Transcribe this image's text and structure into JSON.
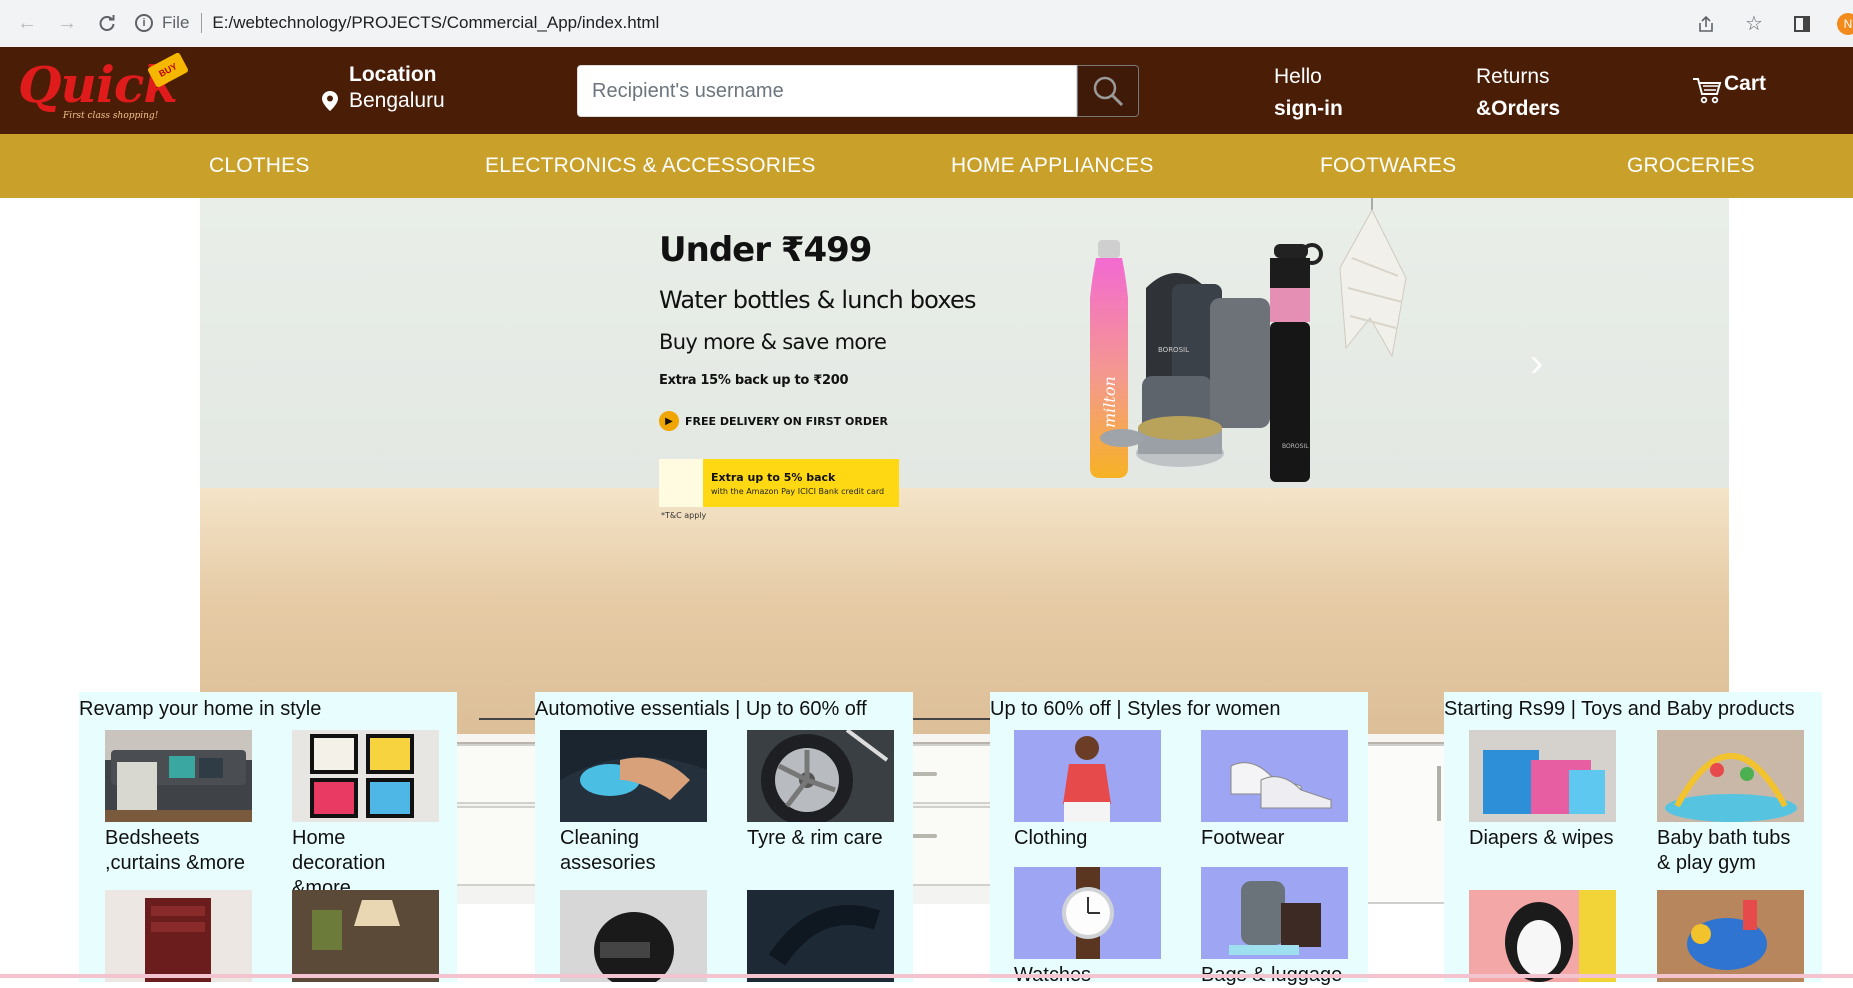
{
  "browser": {
    "scheme_label": "File",
    "url": "E:/webtechnology/PROJECTS/Commercial_App/index.html",
    "profile_initial": "N"
  },
  "header": {
    "logo": {
      "name": "Quick",
      "tagline": "First class shopping!",
      "badge": "BUY"
    },
    "location": {
      "label": "Location",
      "city": "Bengaluru"
    },
    "search": {
      "placeholder": "Recipient's username"
    },
    "account": {
      "line1": "Hello",
      "line2": "sign-in"
    },
    "orders": {
      "line1": "Returns",
      "line2": "&Orders"
    },
    "cart_label": "Cart"
  },
  "categories": [
    "CLOTHES",
    "ELECTRONICS & ACCESSORIES",
    "HOME APPLIANCES",
    "FOOTWARES",
    "GROCERIES"
  ],
  "hero": {
    "headline": "Under ₹499",
    "subhead": "Water bottles & lunch boxes",
    "tagline": "Buy more & save more",
    "offer": "Extra 15% back up to ₹200",
    "delivery": "FREE DELIVERY ON FIRST ORDER",
    "card_title": "Extra up to 5% back",
    "card_sub": "with the Amazon Pay ICICI Bank credit card",
    "tnc": "*T&C apply",
    "bottle_brand": "milton",
    "lunchbox_brand": "BOROSIL"
  },
  "cards": [
    {
      "title": "Revamp your home in style",
      "tiles": [
        {
          "label": "Bedsheets ,curtains &more",
          "icon": "sofa-image"
        },
        {
          "label": "Home decoration &more",
          "icon": "frames-image"
        },
        {
          "label": "",
          "icon": "shoe-rack-image"
        },
        {
          "label": "",
          "icon": "lamp-image"
        }
      ]
    },
    {
      "title": "Automotive essentials | Up to 60% off",
      "tiles": [
        {
          "label": "Cleaning assesories",
          "icon": "car-cleaning-image"
        },
        {
          "label": "Tyre & rim care",
          "icon": "tyre-image"
        },
        {
          "label": "",
          "icon": "helmet-image"
        },
        {
          "label": "",
          "icon": "vacuum-image"
        }
      ]
    },
    {
      "title": "Up to 60% off | Styles for women",
      "tiles": [
        {
          "label": "Clothing",
          "icon": "clothing-image"
        },
        {
          "label": "Footwear",
          "icon": "sneakers-image"
        },
        {
          "label": "Watches",
          "icon": "watch-image"
        },
        {
          "label": "Bags & luggage",
          "icon": "bag-image"
        }
      ]
    },
    {
      "title": "Starting Rs99 | Toys and Baby products",
      "tiles": [
        {
          "label": "Diapers & wipes",
          "icon": "diapers-image"
        },
        {
          "label": "Baby bath tubs & play gym",
          "icon": "play-gym-image"
        },
        {
          "label": "",
          "icon": "penguin-toy-image"
        },
        {
          "label": "",
          "icon": "rocker-toy-image"
        }
      ]
    }
  ],
  "colors": {
    "header_bg": "#4a1d07",
    "category_bar": "#c9a02a",
    "card_bg": "#e8fdfe",
    "logo_red": "#e01b1b"
  }
}
